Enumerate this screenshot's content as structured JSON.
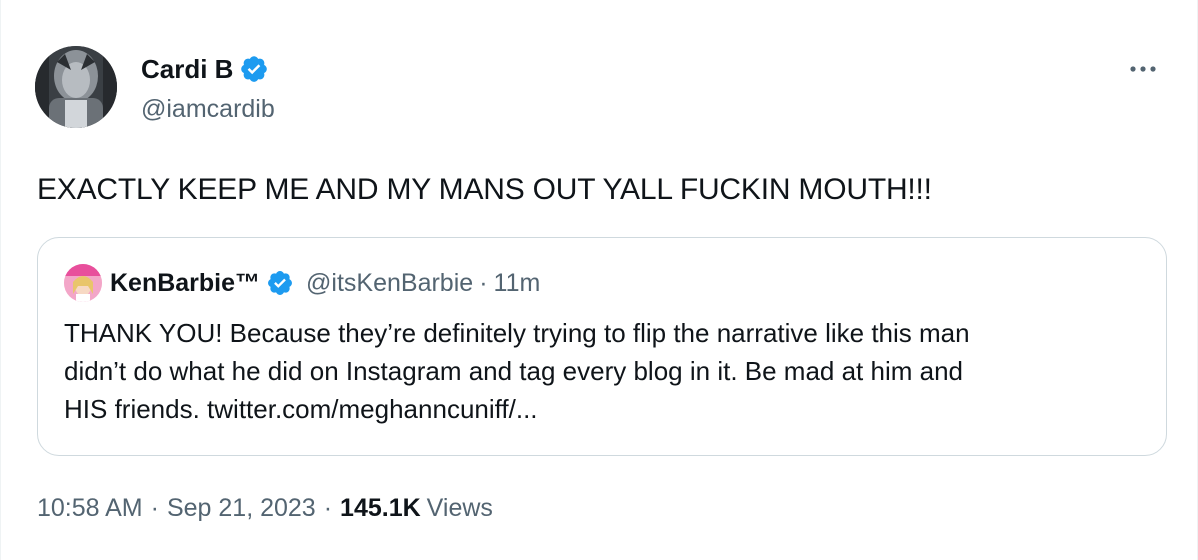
{
  "author": {
    "display_name": "Cardi B",
    "handle": "@iamcardib",
    "verified_color": "#1d9bf0"
  },
  "tweet": {
    "text": "EXACTLY KEEP ME AND MY MANS OUT YALL FUCKIN MOUTH!!!"
  },
  "quoted_tweet": {
    "display_name": "KenBarbie™",
    "handle": "@itsKenBarbie",
    "separator": "·",
    "time": "11m",
    "text_lines": [
      "THANK YOU! Because they’re definitely trying to flip the narrative like this man",
      "didn’t do what he did on Instagram and tag every blog in it. Be mad at him and",
      "HIS friends. twitter.com/meghanncuniff/..."
    ]
  },
  "meta": {
    "time": "10:58 AM",
    "separator": "·",
    "date": "Sep 21, 2023",
    "views_count": "145.1K",
    "views_label": "Views"
  },
  "icons": {
    "more": "more-horizontal-icon",
    "verified": "verified-badge-icon"
  },
  "colors": {
    "text_primary": "#0f1419",
    "text_secondary": "#536471",
    "border": "#cfd9de",
    "accent": "#1d9bf0"
  }
}
